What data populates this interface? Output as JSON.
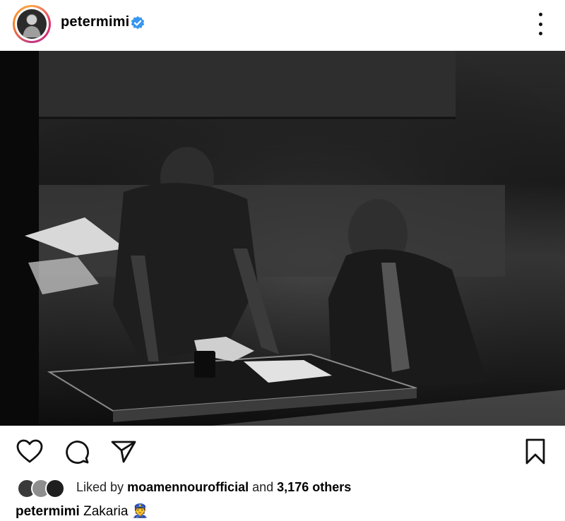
{
  "post": {
    "username": "petermimi",
    "verified": true,
    "more_icon": "more-vertical-icon",
    "photo_alt": "two men at a table"
  },
  "actions": {
    "like_icon": "heart-icon",
    "comment_icon": "comment-icon",
    "share_icon": "send-icon",
    "save_icon": "bookmark-icon"
  },
  "likes": {
    "prefix": "Liked by",
    "user": "moamennourofficial",
    "and": "and",
    "count": "3,176 others"
  },
  "caption": {
    "username": "petermimi",
    "text": "Zakaria",
    "emoji": "👮"
  },
  "colors": {
    "verified_blue": "#3897f0",
    "icon": "#111111"
  }
}
